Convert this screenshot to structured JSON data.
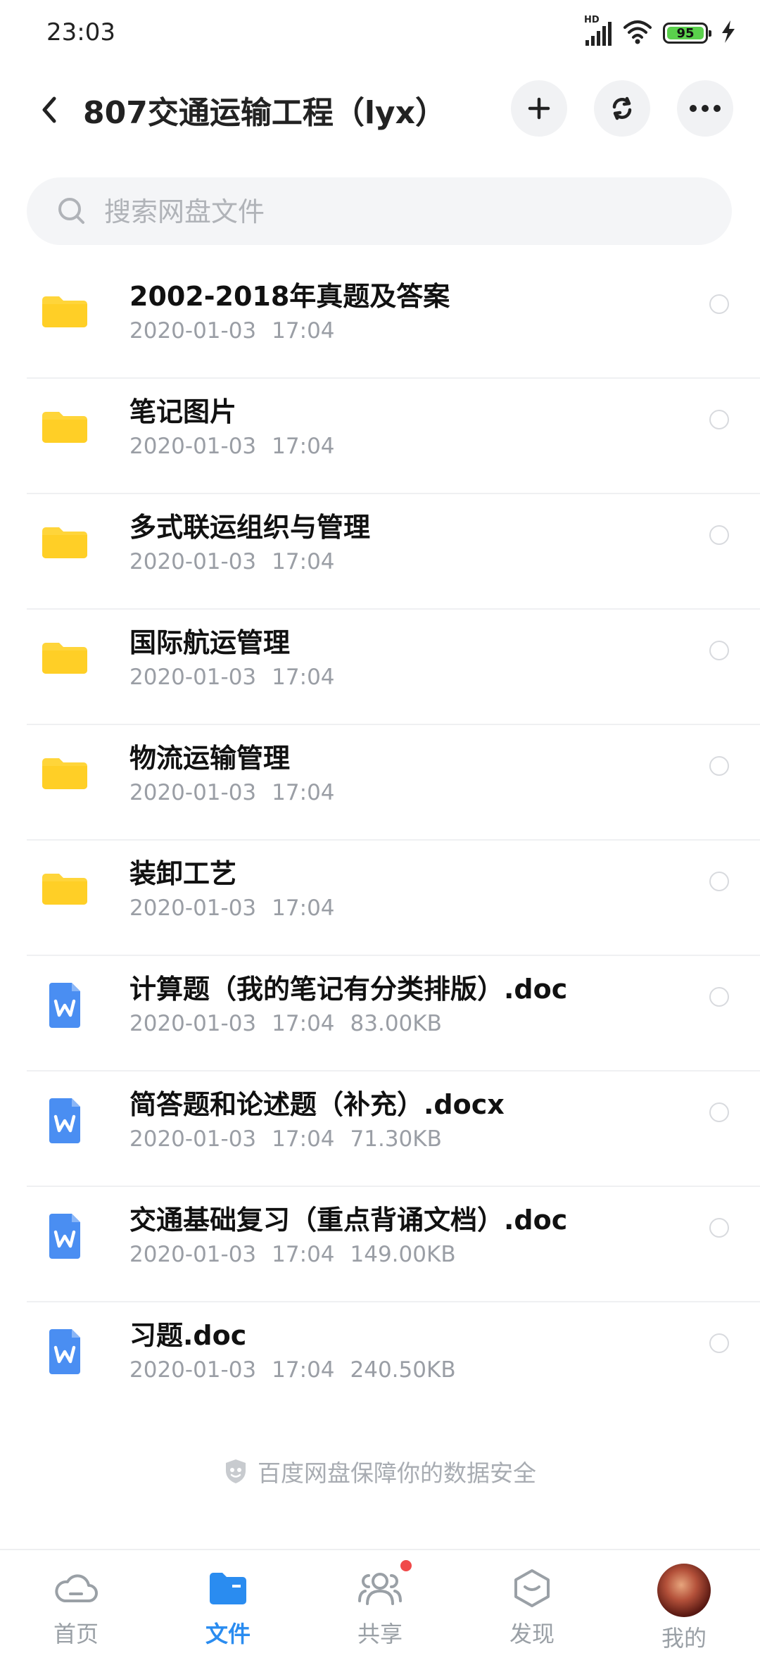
{
  "status_bar": {
    "time": "23:03",
    "network_label": "HD",
    "battery_level": "95"
  },
  "header": {
    "title": "807交通运输工程（lyx）"
  },
  "search": {
    "placeholder": "搜索网盘文件"
  },
  "files": [
    {
      "type": "folder",
      "name": "2002-2018年真题及答案",
      "date": "2020-01-03",
      "time": "17:04",
      "size": ""
    },
    {
      "type": "folder",
      "name": "笔记图片",
      "date": "2020-01-03",
      "time": "17:04",
      "size": ""
    },
    {
      "type": "folder",
      "name": "多式联运组织与管理",
      "date": "2020-01-03",
      "time": "17:04",
      "size": ""
    },
    {
      "type": "folder",
      "name": "国际航运管理",
      "date": "2020-01-03",
      "time": "17:04",
      "size": ""
    },
    {
      "type": "folder",
      "name": "物流运输管理",
      "date": "2020-01-03",
      "time": "17:04",
      "size": ""
    },
    {
      "type": "folder",
      "name": "装卸工艺",
      "date": "2020-01-03",
      "time": "17:04",
      "size": ""
    },
    {
      "type": "doc",
      "name": "计算题（我的笔记有分类排版）.doc",
      "date": "2020-01-03",
      "time": "17:04",
      "size": "83.00KB"
    },
    {
      "type": "doc",
      "name": "简答题和论述题（补充）.docx",
      "date": "2020-01-03",
      "time": "17:04",
      "size": "71.30KB"
    },
    {
      "type": "doc",
      "name": "交通基础复习（重点背诵文档）.doc",
      "date": "2020-01-03",
      "time": "17:04",
      "size": "149.00KB"
    },
    {
      "type": "doc",
      "name": "习题.doc",
      "date": "2020-01-03",
      "time": "17:04",
      "size": "240.50KB"
    }
  ],
  "footer": {
    "safety_text": "百度网盘保障你的数据安全"
  },
  "bottom_nav": [
    {
      "label": "首页",
      "icon": "cloud-icon",
      "active": false
    },
    {
      "label": "文件",
      "icon": "folder-icon",
      "active": true
    },
    {
      "label": "共享",
      "icon": "people-icon",
      "active": false,
      "badge": true
    },
    {
      "label": "发现",
      "icon": "discover-icon",
      "active": false
    },
    {
      "label": "我的",
      "icon": "avatar",
      "active": false
    }
  ],
  "colors": {
    "accent": "#2a8cf0",
    "folder": "#ffd53a",
    "doc": "#4a8ef2",
    "badge": "#f04a4a",
    "battery": "#5ad14c"
  }
}
